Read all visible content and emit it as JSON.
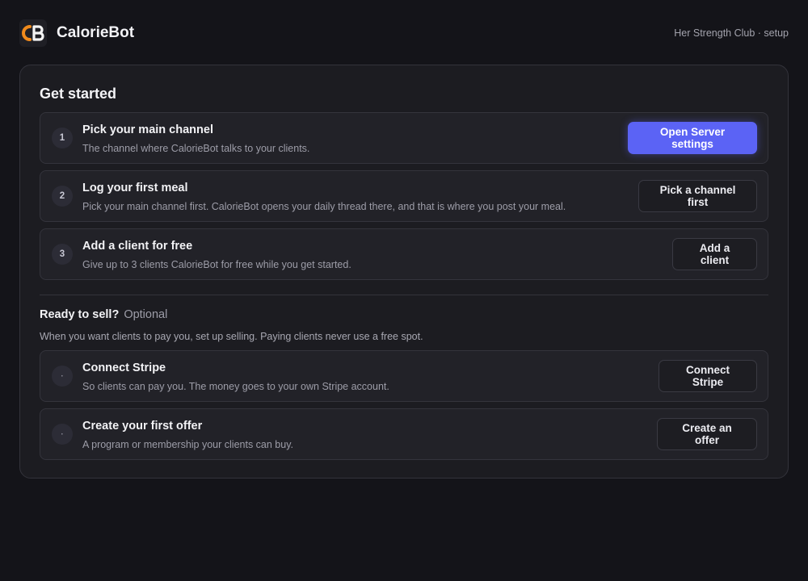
{
  "header": {
    "logo_icon": "calorie-bot-logo",
    "brand": "CalorieBot",
    "context": "Her Strength Club · setup"
  },
  "get_started": {
    "title": "Get started",
    "steps": [
      {
        "number": "1",
        "title": "Pick your main channel",
        "description": "The channel where CalorieBot talks to your clients.",
        "button": "Open Server settings",
        "button_style": "primary"
      },
      {
        "number": "2",
        "title": "Log your first meal",
        "description": "Pick your main channel first. CalorieBot opens your daily thread there, and that is where you post your meal.",
        "button": "Pick a channel first",
        "button_style": "secondary"
      },
      {
        "number": "3",
        "title": "Add a client for free",
        "description": "Give up to 3 clients CalorieBot for free while you get started.",
        "button": "Add a client",
        "button_style": "secondary"
      }
    ]
  },
  "ready_to_sell": {
    "title": "Ready to sell?",
    "optional": "Optional",
    "description": "When you want clients to pay you, set up selling. Paying clients never use a free spot.",
    "steps": [
      {
        "marker": "·",
        "title": "Connect Stripe",
        "description": "So clients can pay you. The money goes to your own Stripe account.",
        "button": "Connect Stripe"
      },
      {
        "marker": "·",
        "title": "Create your first offer",
        "description": "A program or membership your clients can buy.",
        "button": "Create an offer"
      }
    ]
  },
  "colors": {
    "accent": "#5b63f5",
    "logo_orange": "#f08a1c",
    "background": "#141419",
    "panel": "#1c1c21"
  }
}
